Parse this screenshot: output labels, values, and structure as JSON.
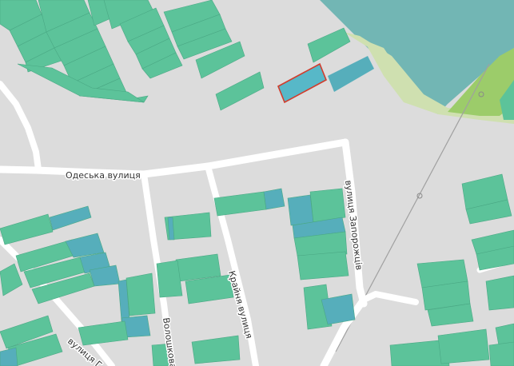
{
  "map": {
    "streets": {
      "odeska": "Одеська вулиця",
      "zaporozhtsiv": "вулиця Запорожців",
      "kraina": "Крайня вулиця",
      "voloshkova": "Волошкова",
      "partial_bottom_left": "вулиця Г"
    },
    "colors": {
      "background": "#dcdcdc",
      "road": "#ffffff",
      "building": "#5cc39a",
      "building_alt": "#56aebb",
      "water_or_forest": "#72b6b4",
      "meadow": "#cfe0b0",
      "green_area": "#9ccc6a",
      "selected_outline": "#d23c2c",
      "selected_fill": "#57b8c8",
      "rail_line": "#a0a0a0"
    }
  }
}
